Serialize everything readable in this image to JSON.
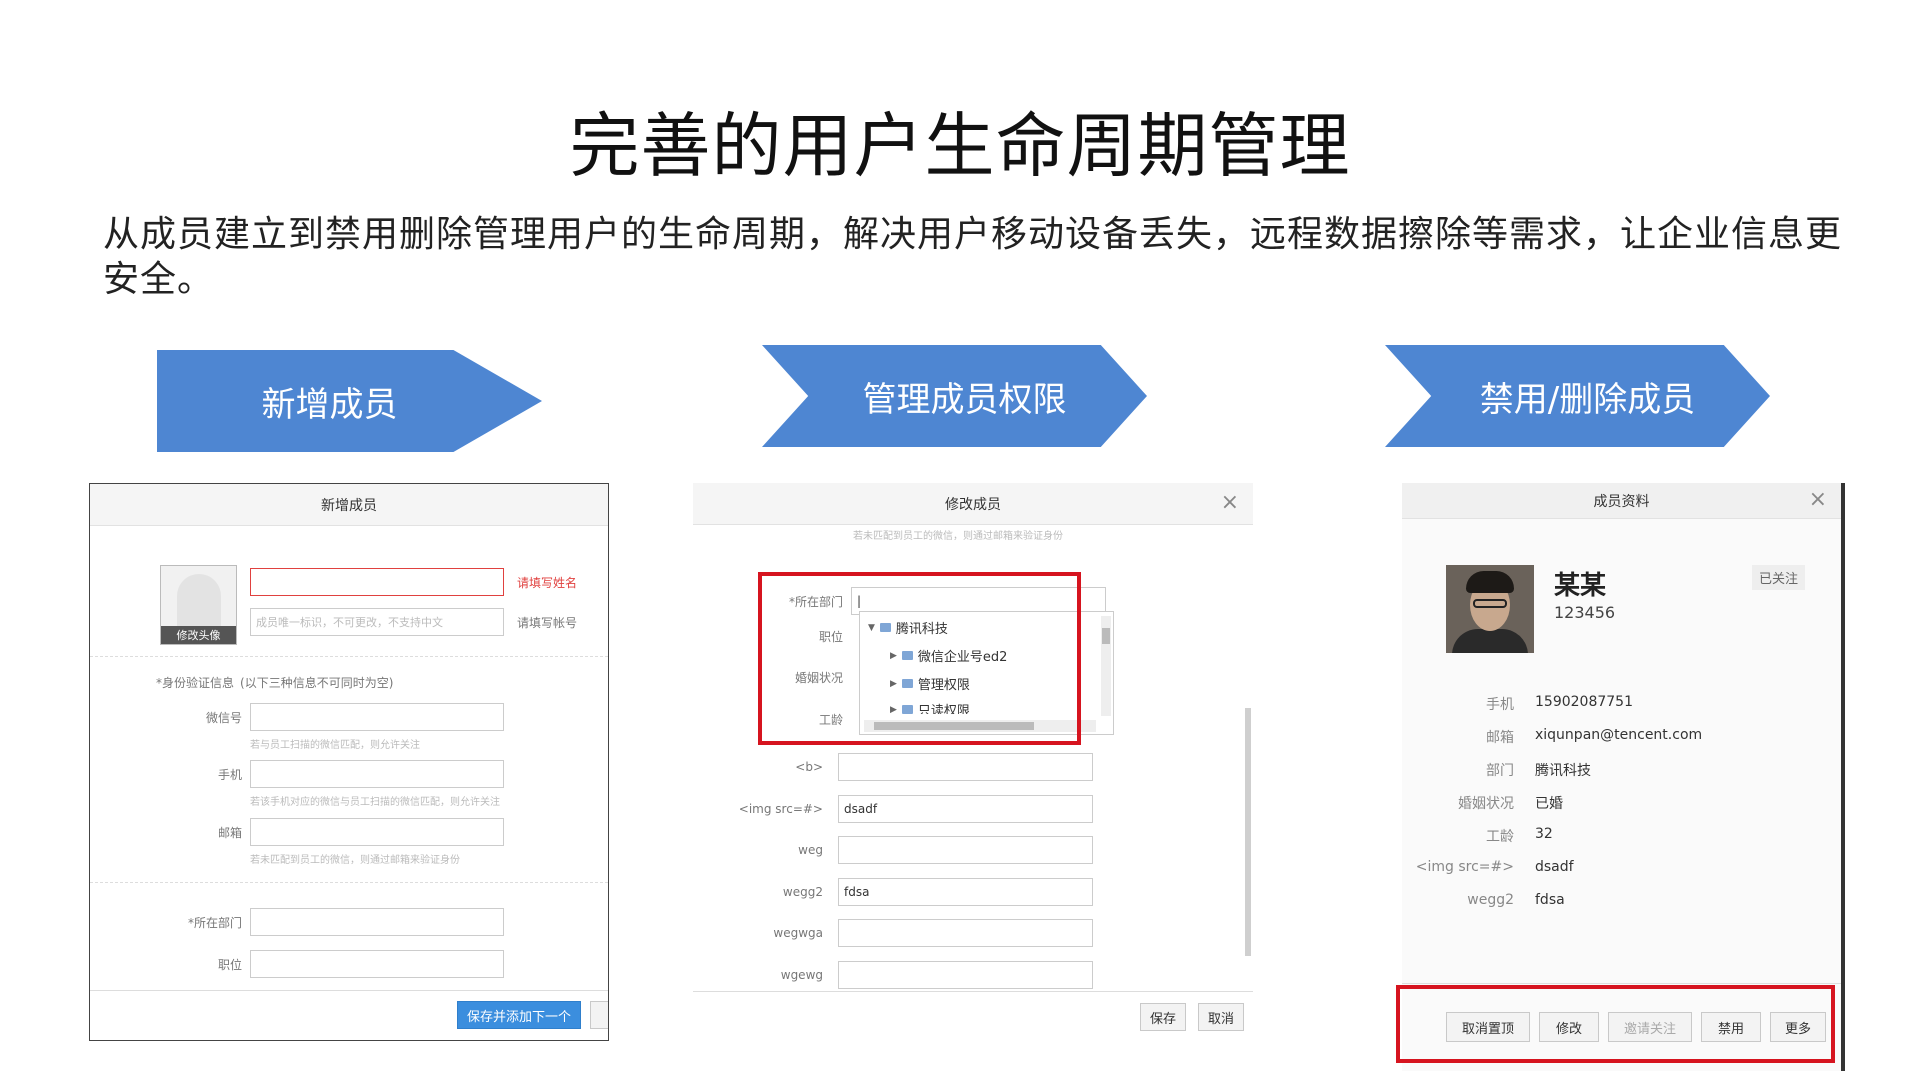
{
  "slide": {
    "title": "完善的用户生命周期管理",
    "description": "从成员建立到禁用删除管理用户的生命周期，解决用户移动设备丢失，远程数据擦除等需求，让企业信息更安全。"
  },
  "steps": [
    {
      "label": "新增成员"
    },
    {
      "label": "管理成员权限"
    },
    {
      "label": "禁用/删除成员"
    }
  ],
  "add_member": {
    "title": "新增成员",
    "avatar_label": "修改头像",
    "name_error": "请填写姓名",
    "account_placeholder": "成员唯一标识，不可更改，不支持中文",
    "account_error": "请填写帐号",
    "verify_label": "*身份验证信息",
    "verify_note": "(以下三种信息不可同时为空)",
    "wechat_label": "微信号",
    "wechat_hint": "若与员工扫描的微信匹配，则允许关注",
    "phone_label": "手机",
    "phone_hint": "若该手机对应的微信与员工扫描的微信匹配，则允许关注",
    "email_label": "邮箱",
    "email_hint": "若未匹配到员工的微信，则通过邮箱来验证身份",
    "dept_label": "*所在部门",
    "position_label": "职位",
    "save_next_button": "保存并添加下一个"
  },
  "edit_member": {
    "title": "修改成员",
    "top_hint": "若未匹配到员工的微信，则通过邮箱来验证身份",
    "dept_label": "*所在部门",
    "position_label": "职位",
    "marital_label": "婚姻状况",
    "seniority_label": "工龄",
    "tree": {
      "root": "腾讯科技",
      "children": [
        "微信企业号ed2",
        "管理权限",
        "只读权限"
      ]
    },
    "fields": [
      {
        "label": "<b>",
        "value": ""
      },
      {
        "label": "<img src=#>",
        "value": "dsadf"
      },
      {
        "label": "weg",
        "value": ""
      },
      {
        "label": "wegg2",
        "value": "fdsa"
      },
      {
        "label": "wegwga",
        "value": ""
      },
      {
        "label": "wgewg",
        "value": ""
      }
    ],
    "save_button": "保存",
    "cancel_button": "取消"
  },
  "member_profile": {
    "title": "成员资料",
    "name": "某某",
    "account": "123456",
    "follow_status": "已关注",
    "info": [
      {
        "key": "手机",
        "value": "15902087751"
      },
      {
        "key": "邮箱",
        "value": "xiqunpan@tencent.com"
      },
      {
        "key": "部门",
        "value": "腾讯科技"
      },
      {
        "key": "婚姻状况",
        "value": "已婚"
      },
      {
        "key": "工龄",
        "value": "32"
      },
      {
        "key": "<img src=#>",
        "value": "dsadf"
      },
      {
        "key": "wegg2",
        "value": "fdsa"
      }
    ],
    "buttons": {
      "unpin": "取消置顶",
      "edit": "修改",
      "invite": "邀请关注",
      "disable": "禁用",
      "more": "更多"
    }
  },
  "colors": {
    "arrow": "#4e86d2",
    "highlight": "#d6141f",
    "primary_button": "#3b8ede",
    "error_text": "#e0413f"
  }
}
